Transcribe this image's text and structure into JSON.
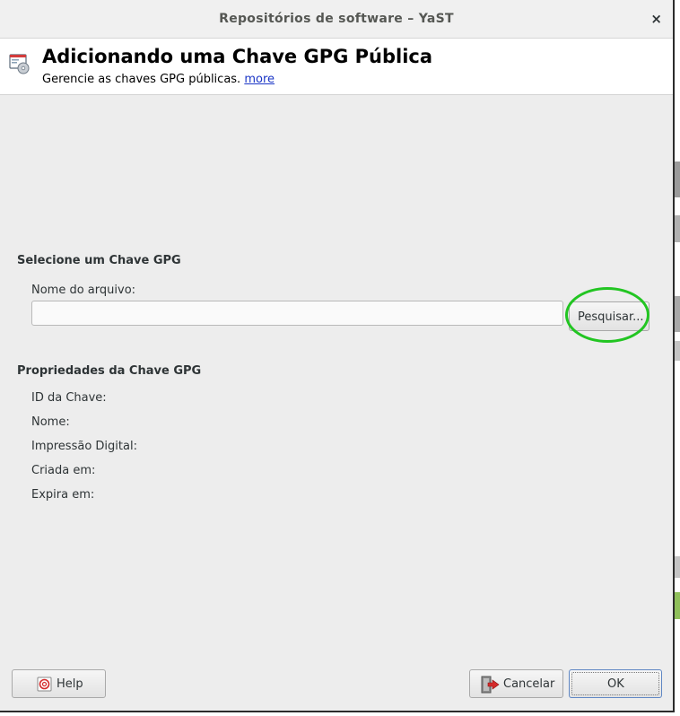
{
  "window": {
    "title": "Repositórios de software – YaST",
    "close_glyph": "×"
  },
  "header": {
    "title": "Adicionando uma Chave GPG Pública",
    "subtitle": "Gerencie as chaves GPG públicas.",
    "more_link": "more",
    "icon": "software-repositories-icon"
  },
  "select_section": {
    "heading": "Selecione um Chave GPG",
    "filename_label": "Nome do arquivo:",
    "filename_value": "",
    "browse_button": "Pesquisar..."
  },
  "properties_section": {
    "heading": "Propriedades da Chave GPG",
    "key_id_label": "ID da Chave:",
    "name_label": "Nome:",
    "fingerprint_label": "Impressão Digital:",
    "created_label": "Criada em:",
    "expires_label": "Expira em:"
  },
  "footer": {
    "help_button": "Help",
    "cancel_button": "Cancelar",
    "ok_button": "OK"
  },
  "colors": {
    "highlight_circle": "#22c522",
    "link": "#1a35c6"
  }
}
